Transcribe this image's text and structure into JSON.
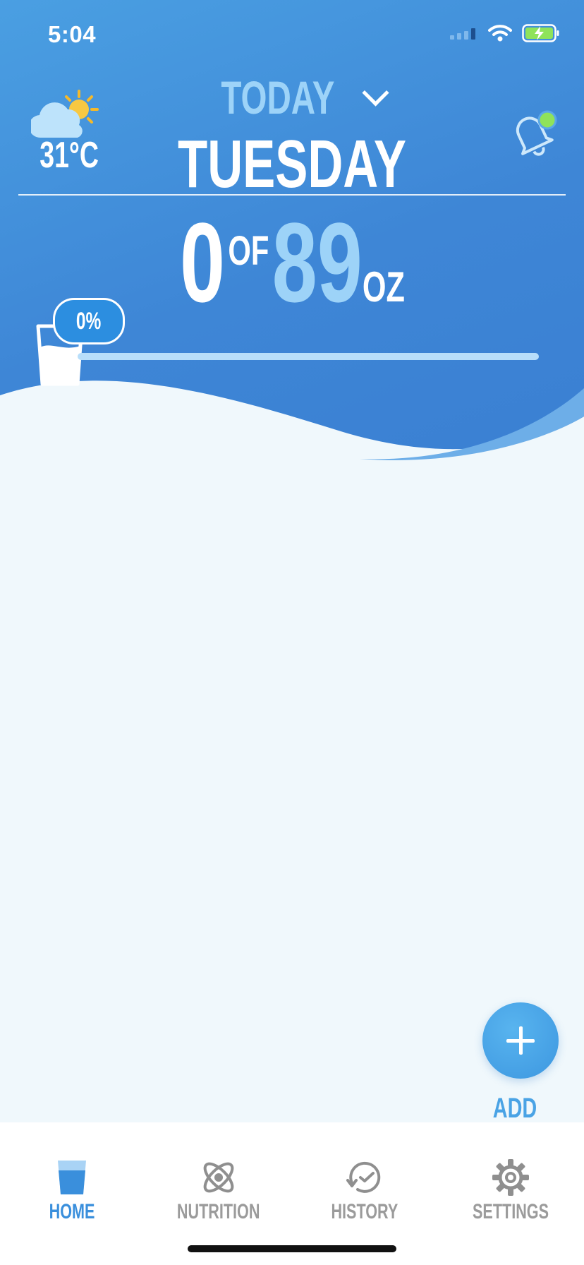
{
  "status_bar": {
    "time": "5:04"
  },
  "weather": {
    "temperature": "31°C",
    "icon": "partly-cloudy-icon"
  },
  "date_selector": {
    "label": "TODAY",
    "day": "TUESDAY"
  },
  "intake": {
    "current": "0",
    "of_label": "OF",
    "goal": "89",
    "unit": "OZ"
  },
  "progress": {
    "percent_label": "0%",
    "fraction": 0.0
  },
  "add_drink": {
    "label": "ADD DRINK"
  },
  "tabs": [
    {
      "label": "HOME",
      "icon": "glass-icon",
      "active": true
    },
    {
      "label": "NUTRITION",
      "icon": "atom-icon",
      "active": false
    },
    {
      "label": "HISTORY",
      "icon": "clock-history-icon",
      "active": false
    },
    {
      "label": "SETTINGS",
      "icon": "gear-icon",
      "active": false
    }
  ],
  "colors": {
    "accent": "#3a8fdc",
    "header": "#4592dc",
    "indicator": "#8fe35a"
  }
}
